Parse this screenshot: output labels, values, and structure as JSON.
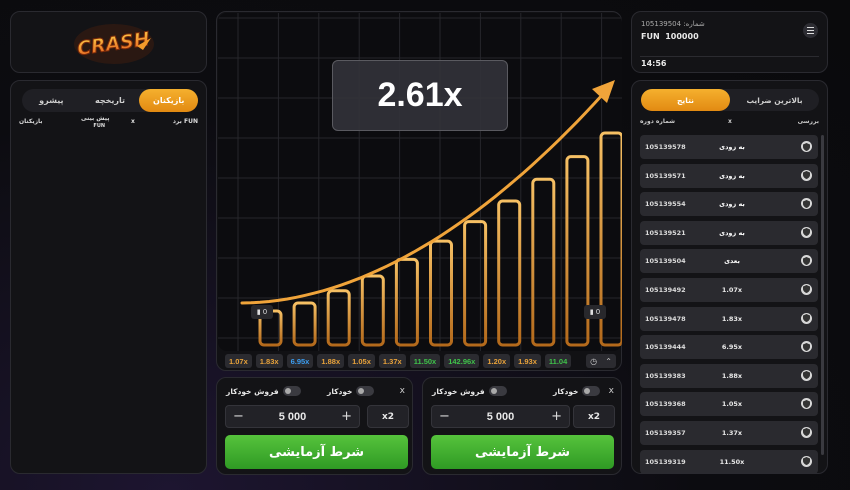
{
  "logo": {
    "text": "CRASH"
  },
  "bets_panel": {
    "tabs": [
      "بازیکنان",
      "تاریخچه",
      "پیشرو"
    ],
    "active_tab": 0,
    "col_player": "بازیکنان",
    "col_prediction": "پیش بینی",
    "col_prediction_unit": "FUN",
    "col_x": "x",
    "col_win": "برد FUN"
  },
  "graph": {
    "multiplier": "2.61x",
    "left_chip": "0",
    "right_chip": "0"
  },
  "history": [
    {
      "v": "1.07x",
      "color": "#e8a23a"
    },
    {
      "v": "1.83x",
      "color": "#e8a23a"
    },
    {
      "v": "6.95x",
      "color": "#3b9df0"
    },
    {
      "v": "1.88x",
      "color": "#e8a23a"
    },
    {
      "v": "1.05x",
      "color": "#e8a23a"
    },
    {
      "v": "1.37x",
      "color": "#e8a23a"
    },
    {
      "v": "11.50x",
      "color": "#3fc24a"
    },
    {
      "v": "142.96x",
      "color": "#3fc24a"
    },
    {
      "v": "1.20x",
      "color": "#e8a23a"
    },
    {
      "v": "1.93x",
      "color": "#e8a23a"
    },
    {
      "v": "11.04",
      "color": "#3fc24a"
    }
  ],
  "bet_left": {
    "auto_label": "خودکار",
    "auto_sell_label": "فروش خودکار",
    "amount": "5 000",
    "multiplier_btn": "x2",
    "place_label": "شرط آزمایشی",
    "close": "x"
  },
  "bet_right": {
    "auto_label": "خودکار",
    "auto_sell_label": "فروش خودکار",
    "amount": "5 000",
    "multiplier_btn": "x2",
    "place_label": "شرط آزمایشی",
    "close": "x"
  },
  "user": {
    "id_line": "105139504 :شماره",
    "currency": "FUN",
    "balance": "100000",
    "time": "14:56"
  },
  "results_panel": {
    "tabs": [
      "بالاترین ضرایب",
      "نتایج"
    ],
    "active_tab": 1,
    "col_round": "شماره دوره",
    "col_x": "x",
    "col_check": "بررسی",
    "rows": [
      {
        "round": "105139578",
        "mult": "به زودی",
        "color": "#ffffff"
      },
      {
        "round": "105139571",
        "mult": "به زودی",
        "color": "#ffffff"
      },
      {
        "round": "105139554",
        "mult": "به زودی",
        "color": "#ffffff"
      },
      {
        "round": "105139521",
        "mult": "به زودی",
        "color": "#ffffff"
      },
      {
        "round": "105139504",
        "mult": "بعدی",
        "color": "#ffffff"
      },
      {
        "round": "105139492",
        "mult": "1.07x",
        "color": "#e8e8e8"
      },
      {
        "round": "105139478",
        "mult": "1.83x",
        "color": "#e8e8e8"
      },
      {
        "round": "105139444",
        "mult": "6.95x",
        "color": "#e8e8e8"
      },
      {
        "round": "105139383",
        "mult": "1.88x",
        "color": "#e8e8e8"
      },
      {
        "round": "105139368",
        "mult": "1.05x",
        "color": "#e8e8e8"
      },
      {
        "round": "105139357",
        "mult": "1.37x",
        "color": "#e8e8e8"
      },
      {
        "round": "105139319",
        "mult": "11.50x",
        "color": "#e8e8e8"
      }
    ]
  }
}
